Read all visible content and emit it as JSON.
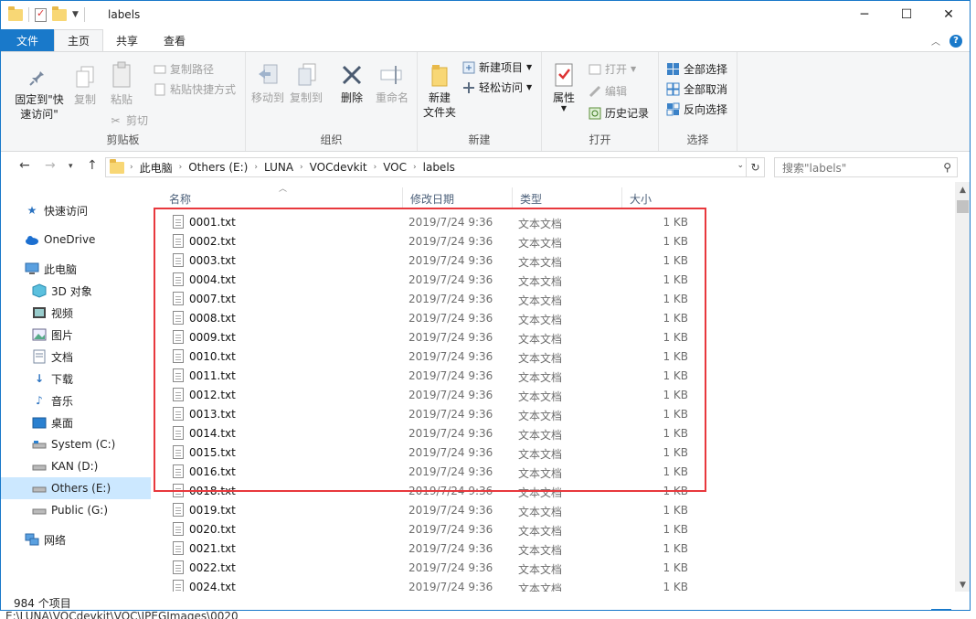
{
  "window": {
    "title": "labels",
    "minimize": "─",
    "maximize": "☐",
    "close": "✕"
  },
  "tabs": [
    {
      "label": "文件"
    },
    {
      "label": "主页"
    },
    {
      "label": "共享"
    },
    {
      "label": "查看"
    }
  ],
  "ribbon": {
    "clipboard": {
      "pin_label_1": "固定到\"快",
      "pin_label_2": "速访问\"",
      "copy": "复制",
      "paste": "粘贴",
      "copy_path": "复制路径",
      "paste_shortcut": "粘贴快捷方式",
      "cut": "剪切",
      "group": "剪贴板"
    },
    "organize": {
      "move_to": "移动到",
      "copy_to": "复制到",
      "delete": "删除",
      "rename": "重命名",
      "group": "组织"
    },
    "new": {
      "new_folder_1": "新建",
      "new_folder_2": "文件夹",
      "new_item": "新建项目",
      "easy_access": "轻松访问",
      "group": "新建"
    },
    "open": {
      "properties": "属性",
      "open": "打开",
      "edit": "编辑",
      "history": "历史记录",
      "group": "打开"
    },
    "select": {
      "select_all": "全部选择",
      "select_none": "全部取消",
      "invert": "反向选择",
      "group": "选择"
    }
  },
  "address": {
    "crumbs": [
      "此电脑",
      "Others (E:)",
      "LUNA",
      "VOCdevkit",
      "VOC",
      "labels"
    ],
    "search_placeholder": "搜索\"labels\""
  },
  "nav": [
    {
      "label": "快速访问",
      "icon": "star-icon"
    },
    {
      "label": "OneDrive",
      "icon": "cloud-icon"
    },
    {
      "label": "此电脑",
      "icon": "computer-icon"
    },
    {
      "label": "3D 对象",
      "icon": "cube-icon"
    },
    {
      "label": "视频",
      "icon": "video-icon"
    },
    {
      "label": "图片",
      "icon": "picture-icon"
    },
    {
      "label": "文档",
      "icon": "document-icon"
    },
    {
      "label": "下载",
      "icon": "download-icon"
    },
    {
      "label": "音乐",
      "icon": "music-icon"
    },
    {
      "label": "桌面",
      "icon": "desktop-icon"
    },
    {
      "label": "System (C:)",
      "icon": "drive-icon"
    },
    {
      "label": "KAN (D:)",
      "icon": "drive-icon"
    },
    {
      "label": "Others (E:)",
      "icon": "drive-icon"
    },
    {
      "label": "Public (G:)",
      "icon": "drive-icon"
    },
    {
      "label": "网络",
      "icon": "network-icon"
    }
  ],
  "columns": {
    "name": "名称",
    "date": "修改日期",
    "type": "类型",
    "size": "大小"
  },
  "files": [
    {
      "name": "0001.txt",
      "date": "2019/7/24 9:36",
      "type": "文本文档",
      "size": "1 KB"
    },
    {
      "name": "0002.txt",
      "date": "2019/7/24 9:36",
      "type": "文本文档",
      "size": "1 KB"
    },
    {
      "name": "0003.txt",
      "date": "2019/7/24 9:36",
      "type": "文本文档",
      "size": "1 KB"
    },
    {
      "name": "0004.txt",
      "date": "2019/7/24 9:36",
      "type": "文本文档",
      "size": "1 KB"
    },
    {
      "name": "0007.txt",
      "date": "2019/7/24 9:36",
      "type": "文本文档",
      "size": "1 KB"
    },
    {
      "name": "0008.txt",
      "date": "2019/7/24 9:36",
      "type": "文本文档",
      "size": "1 KB"
    },
    {
      "name": "0009.txt",
      "date": "2019/7/24 9:36",
      "type": "文本文档",
      "size": "1 KB"
    },
    {
      "name": "0010.txt",
      "date": "2019/7/24 9:36",
      "type": "文本文档",
      "size": "1 KB"
    },
    {
      "name": "0011.txt",
      "date": "2019/7/24 9:36",
      "type": "文本文档",
      "size": "1 KB"
    },
    {
      "name": "0012.txt",
      "date": "2019/7/24 9:36",
      "type": "文本文档",
      "size": "1 KB"
    },
    {
      "name": "0013.txt",
      "date": "2019/7/24 9:36",
      "type": "文本文档",
      "size": "1 KB"
    },
    {
      "name": "0014.txt",
      "date": "2019/7/24 9:36",
      "type": "文本文档",
      "size": "1 KB"
    },
    {
      "name": "0015.txt",
      "date": "2019/7/24 9:36",
      "type": "文本文档",
      "size": "1 KB"
    },
    {
      "name": "0016.txt",
      "date": "2019/7/24 9:36",
      "type": "文本文档",
      "size": "1 KB"
    },
    {
      "name": "0018.txt",
      "date": "2019/7/24 9:36",
      "type": "文本文档",
      "size": "1 KB"
    },
    {
      "name": "0019.txt",
      "date": "2019/7/24 9:36",
      "type": "文本文档",
      "size": "1 KB"
    },
    {
      "name": "0020.txt",
      "date": "2019/7/24 9:36",
      "type": "文本文档",
      "size": "1 KB"
    },
    {
      "name": "0021.txt",
      "date": "2019/7/24 9:36",
      "type": "文本文档",
      "size": "1 KB"
    },
    {
      "name": "0022.txt",
      "date": "2019/7/24 9:36",
      "type": "文本文档",
      "size": "1 KB"
    },
    {
      "name": "0024.txt",
      "date": "2019/7/24 9:36",
      "type": "文本文档",
      "size": "1 KB"
    }
  ],
  "status": {
    "item_count": "984 个项目"
  },
  "underlay": {
    "text": "E:\\LUNA\\VOCdevkit\\VOC\\JPEGImages\\0020"
  },
  "colors": {
    "accent": "#1979ca",
    "highlight_box": "#e8383d",
    "selected_nav": "#cce8ff"
  }
}
